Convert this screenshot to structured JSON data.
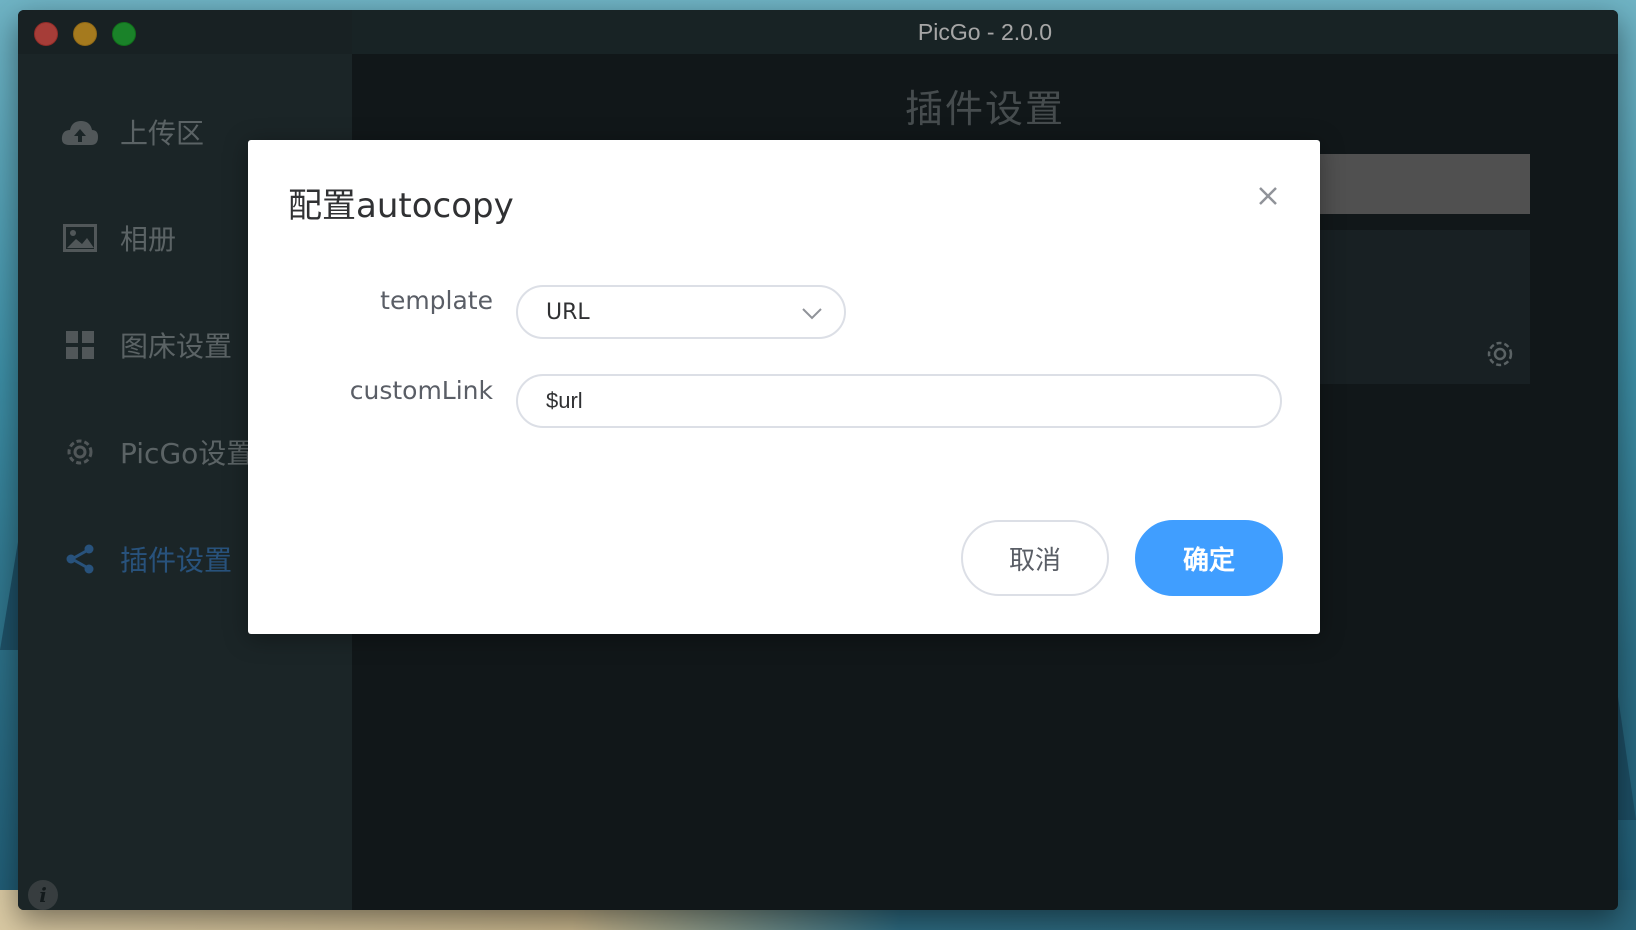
{
  "window": {
    "title": "PicGo - 2.0.0"
  },
  "sidebar": {
    "items": [
      {
        "label": "上传区",
        "icon": "cloud-upload-icon"
      },
      {
        "label": "相册",
        "icon": "image-icon"
      },
      {
        "label": "图床设置",
        "icon": "grid-icon"
      },
      {
        "label": "PicGo设置",
        "icon": "gear-icon"
      },
      {
        "label": "插件设置",
        "icon": "share-icon"
      }
    ],
    "active_index": 4,
    "info_label": "i"
  },
  "main": {
    "title": "插件设置"
  },
  "dialog": {
    "title": "配置autocopy",
    "fields": {
      "template": {
        "label": "template",
        "value": "URL"
      },
      "customLink": {
        "label": "customLink",
        "value": "$url"
      }
    },
    "cancel_label": "取消",
    "ok_label": "确定"
  },
  "colors": {
    "accent": "#409eff",
    "sidebar_active": "#3e7fbf",
    "window_bg": "#1b2427"
  }
}
